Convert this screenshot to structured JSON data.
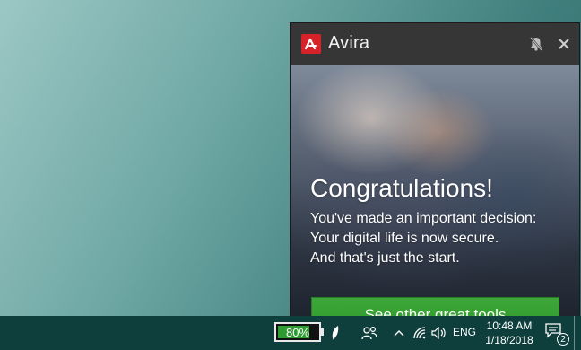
{
  "popup": {
    "brand": "Avira",
    "headline": "Congratulations!",
    "body_lines": [
      "You've made an important decision:",
      "Your digital life is now secure.",
      "And that's just the start."
    ],
    "cta_label": "See other great tools",
    "icons": {
      "logo": "avira-logo-icon",
      "mute": "bell-muted-icon",
      "close": "close-icon"
    }
  },
  "taskbar": {
    "battery_percent": 80,
    "battery_label": "80%",
    "language": "ENG",
    "time": "10:48 AM",
    "date": "1/18/2018",
    "notification_count": "2",
    "icons": {
      "battery": "battery-icon",
      "feather": "feather-icon",
      "people": "people-icon",
      "chevron": "chevron-up-icon",
      "wifi": "wifi-icon",
      "volume": "volume-icon",
      "notifications": "action-center-icon"
    }
  },
  "colors": {
    "accent_red": "#d7222a",
    "cta_green": "#2f9a2c",
    "taskbar_bg": "#0e3f3c"
  }
}
